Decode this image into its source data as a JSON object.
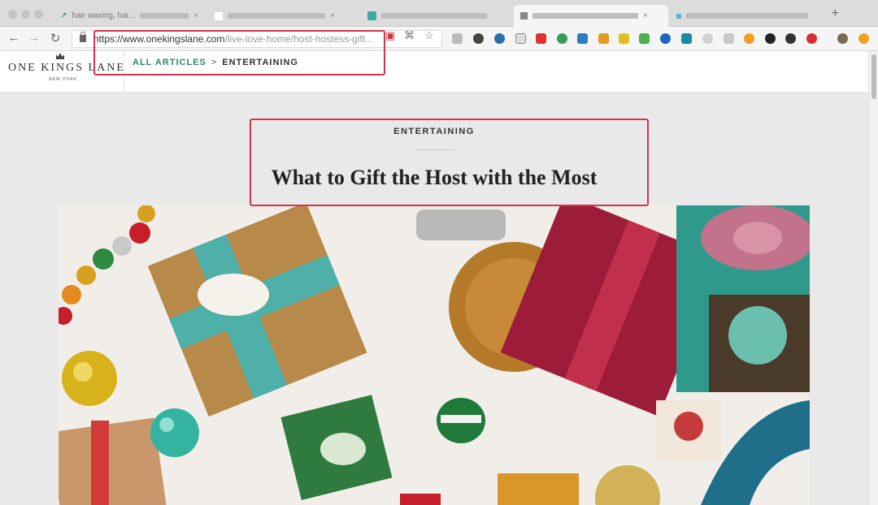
{
  "browser": {
    "tabs": [
      {
        "label": "hair waxing, hai..."
      },
      {
        "label": ""
      },
      {
        "label": ""
      },
      {
        "label": ""
      },
      {
        "label": ""
      }
    ],
    "url": {
      "host": "https://www.onekingslane.com",
      "path": "/live-love-home/host-hostess-gift..."
    }
  },
  "site": {
    "logo": "ONE KINGS LANE",
    "logo_sub": "NEW YORK",
    "breadcrumb": {
      "link": "ALL ARTICLES",
      "separator": ">",
      "current": "ENTERTAINING"
    }
  },
  "article": {
    "kicker": "ENTERTAINING",
    "title": "What to Gift the Host with the Most"
  },
  "colors": {
    "accent": "#2a8a6a",
    "highlight": "#d6334a"
  }
}
